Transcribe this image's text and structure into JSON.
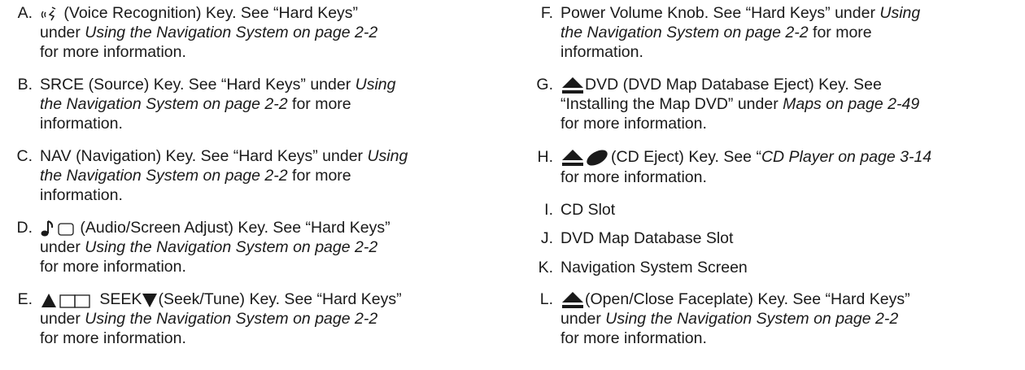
{
  "items": {
    "A": {
      "letter": "A.",
      "icon": "voice-recognition-icon",
      "line1": " (Voice Recognition) Key. See “Hard Keys”",
      "line2a": "under ",
      "line2b": "Using the Navigation System on page 2-2",
      "line3": "for more information."
    },
    "B": {
      "letter": "B.",
      "line1a": "SRCE (Source) Key. See “Hard Keys” under ",
      "line1b": "Using",
      "line2a": "the Navigation System on page 2-2",
      "line2b": " for more",
      "line3": "information."
    },
    "C": {
      "letter": "C.",
      "line1a": "NAV (Navigation) Key. See “Hard Keys” under ",
      "line1b": "Using",
      "line2a": "the Navigation System on page 2-2",
      "line2b": " for more",
      "line3": "information."
    },
    "D": {
      "letter": "D.",
      "icon": "audio-screen-adjust-icon",
      "line1": " (Audio/Screen Adjust) Key. See “Hard Keys”",
      "line2a": "under ",
      "line2b": "Using the Navigation System on page 2-2",
      "line3": "for more information."
    },
    "E": {
      "letter": "E.",
      "icon": "seek-tune-icon",
      "line1a": " SEEK",
      "line1b": "(Seek/Tune) Key. See “Hard Keys”",
      "line2a": "under ",
      "line2b": "Using the Navigation System on page 2-2",
      "line3": "for more information."
    },
    "F": {
      "letter": "F.",
      "line1a": "Power Volume Knob. See “Hard Keys” under ",
      "line1b": "Using",
      "line2a": "the Navigation System on page 2-2",
      "line2b": " for more",
      "line3": "information."
    },
    "G": {
      "letter": "G.",
      "icon": "eject-icon",
      "line1": "DVD (DVD Map Database Eject) Key. See",
      "line2a": "“Installing the Map DVD” under ",
      "line2b": "Maps on page 2-49",
      "line3": "for more information."
    },
    "H": {
      "letter": "H.",
      "icon": "cd-eject-icon",
      "line1a": "(CD Eject) Key. See “",
      "line1b": "CD Player on page 3-14",
      "line2": "for more information."
    },
    "I": {
      "letter": "I.",
      "text": "CD Slot"
    },
    "J": {
      "letter": "J.",
      "text": "DVD Map Database Slot"
    },
    "K": {
      "letter": "K.",
      "text": "Navigation System Screen"
    },
    "L": {
      "letter": "L.",
      "icon": "eject-icon",
      "line1": "(Open/Close Faceplate) Key. See “Hard Keys”",
      "line2a": "under ",
      "line2b": "Using the Navigation System on page 2-2",
      "line3": "for more information."
    }
  }
}
